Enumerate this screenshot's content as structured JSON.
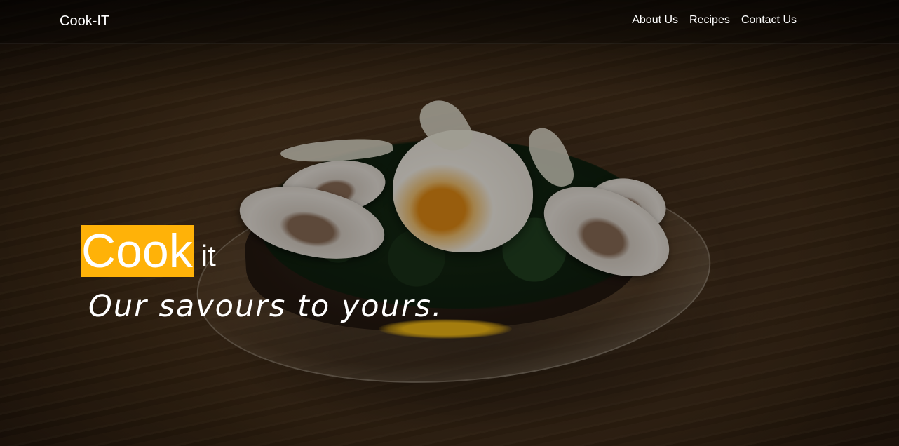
{
  "navbar": {
    "brand": "Cook-IT",
    "links": [
      {
        "label": "About Us"
      },
      {
        "label": "Recipes"
      },
      {
        "label": "Contact Us"
      }
    ]
  },
  "hero": {
    "highlight_word": "Cook",
    "rest_word": "it",
    "tagline": "Our savours to yours."
  },
  "colors": {
    "accent": "#ffb208",
    "text": "#ffffff"
  }
}
